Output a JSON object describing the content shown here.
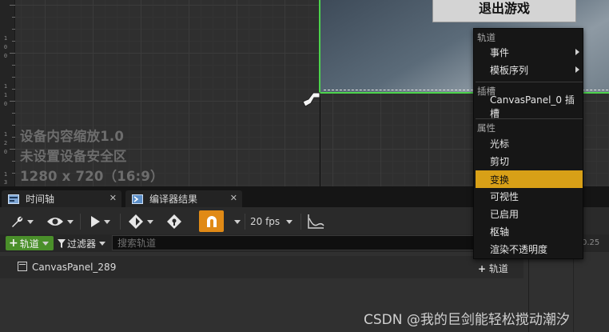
{
  "viewport": {
    "exit_button_label": "退出游戏",
    "ruler_numbers": [
      "1",
      "0",
      "0",
      "1",
      "1",
      "0",
      "1",
      "2",
      "0",
      "1",
      "3",
      "0"
    ],
    "dpi_info": {
      "scale_line": "设备内容缩放1.0",
      "safe_zone_line": "未设置设备安全区",
      "resolution_line": "1280 x 720（16:9）"
    }
  },
  "tabs": [
    {
      "label": "时间轴",
      "icon": "timeline-icon"
    },
    {
      "label": "编译器结果",
      "icon": "compiler-results-icon"
    }
  ],
  "toolbar": {
    "buttons": [
      "wrench-icon",
      "eye-icon",
      "play-icon",
      "keyframe-icon",
      "snap-tool-icon",
      "magnet-snap-icon",
      "curve-icon"
    ],
    "fps_label": "20 fps"
  },
  "filter_row": {
    "add_track_label": "轨道",
    "filter_label": "过滤器",
    "search_placeholder": "搜索轨道"
  },
  "tracks": [
    {
      "name": "CanvasPanel_289",
      "add_label": "轨道"
    }
  ],
  "timeline": {
    "tick_label": "0.25"
  },
  "context_menu": {
    "sections": [
      {
        "header": "轨道",
        "items": [
          {
            "label": "事件",
            "submenu": true
          },
          {
            "label": "模板序列",
            "submenu": true
          }
        ]
      },
      {
        "header": "插槽",
        "items": [
          {
            "label": "CanvasPanel_0 插槽",
            "submenu": false
          }
        ]
      },
      {
        "header": "属性",
        "items": [
          {
            "label": "光标",
            "submenu": false
          },
          {
            "label": "剪切",
            "submenu": false
          },
          {
            "label": "变换",
            "submenu": false,
            "selected": true
          },
          {
            "label": "可视性",
            "submenu": false
          },
          {
            "label": "已启用",
            "submenu": false
          },
          {
            "label": "枢轴",
            "submenu": false
          },
          {
            "label": "渲染不透明度",
            "submenu": false
          }
        ]
      }
    ]
  },
  "watermark": "CSDN @我的巨剑能轻松搅动潮汐",
  "colors": {
    "accent_orange": "#e08a16",
    "selected_item": "#d8a017",
    "add_track_green": "#4a8f2a",
    "canvas_border_green": "#4dd34d"
  }
}
